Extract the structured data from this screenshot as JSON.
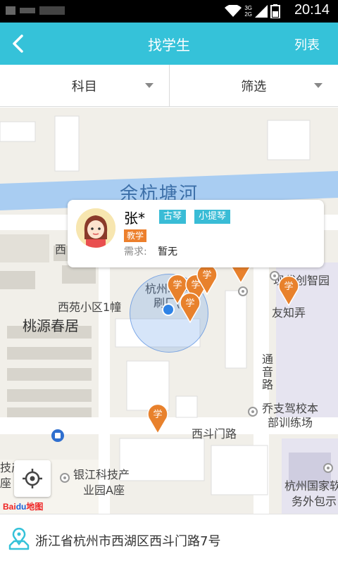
{
  "status_bar": {
    "time": "20:14",
    "net_top": "3G",
    "net_bottom": "2G"
  },
  "header": {
    "title": "找学生",
    "right_action": "列表"
  },
  "filters": [
    {
      "label": "科目"
    },
    {
      "label": "筛选"
    }
  ],
  "map": {
    "labels": {
      "river": "余杭塘河",
      "community": "桃源春居",
      "xiyuan": "西苑小区1幢",
      "print": "杭州印刷厂",
      "print2": "刷厂(路)",
      "modern": "现代创智园",
      "youzhi": "友知弄",
      "tongyin1": "通",
      "tongyin2": "音",
      "tongyin3": "路",
      "driving1": "乔支驾校本",
      "driving2": "部训练场",
      "xidou": "西斗门路",
      "yinjiang1": "银江科技产",
      "yinjiang2": "业园A座",
      "hznat1": "杭州国家软",
      "hznat2": "务外包示",
      "left1": "技产",
      "left2": "座",
      "xi": "西"
    },
    "pin_label": "学",
    "baidu_left": "Bai",
    "baidu_du": "du",
    "baidu_right": "地图"
  },
  "popup": {
    "name": "张*",
    "tags": [
      "古琴",
      "小提琴"
    ],
    "teach_tag": "教学",
    "need_label": "需求:",
    "need_value": "暂无"
  },
  "address": {
    "text": "浙江省杭州市西湖区西斗门路7号"
  },
  "colors": {
    "header": "#35c2d9",
    "pin": "#e8812c",
    "tag": "#39bcd6",
    "teach": "#ec7f2c"
  }
}
